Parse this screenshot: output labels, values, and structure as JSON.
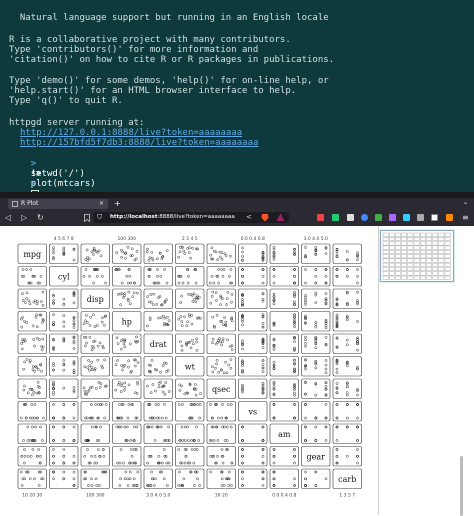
{
  "terminal": {
    "lines": [
      "  Natural language support but running in an English locale",
      "",
      "R is a collaborative project with many contributors.",
      "Type 'contributors()' for more information and",
      "'citation()' on how to cite R or R packages in publications.",
      "",
      "Type 'demo()' for some demos, 'help()' for on-line help, or",
      "'help.start()' for an HTML browser interface to help.",
      "Type 'q()' to quit R.",
      "",
      "httpgd server running at:"
    ],
    "links": [
      "http://127.0.0.1:8888/live?token=aaaaaaaa",
      "http://157bfd5f7db3:8888/live?token=aaaaaaaa"
    ],
    "prompt1": ">",
    "cmd1": "setwd('/')",
    "warn2": "!>",
    "cmd2": "plot(mtcars)",
    "prompt3": ">"
  },
  "browser": {
    "tab_title": "R Plot",
    "tab_close": "×",
    "new_tab": "+",
    "tab_menu": "⌄",
    "url_host": "http://localhost",
    "url_rest": ":8888/live?token=aaaaaaaa"
  },
  "icons": {
    "back": "back-arrow-icon",
    "forward": "forward-arrow-icon",
    "reload": "reload-icon",
    "bookmark": "bookmark-icon",
    "shield": "shield-icon",
    "share": "share-icon",
    "brave": "brave-lion-icon",
    "rewards": "rewards-triangle-icon"
  },
  "plot": {
    "variables": [
      "mpg",
      "cyl",
      "disp",
      "hp",
      "drat",
      "wt",
      "qsec",
      "vs",
      "am",
      "gear",
      "carb"
    ],
    "top_ticks": [
      "4 5 6 7 8",
      "100  300",
      "2 3 4 5",
      "0.0 0.4 0.8",
      "3.0 4.0 5.0"
    ],
    "bottom_ticks": [
      "10 20 30",
      "100 300",
      "3.0 4.0 5.0",
      "16 20",
      "0.0 0.4 0.8",
      "1 3 5 7"
    ]
  },
  "colors": {
    "terminal_bg": "#0f3a3d",
    "terminal_text": "#cfe1e1",
    "link": "#5fa8e6",
    "browser_chrome": "#2b2a33"
  }
}
